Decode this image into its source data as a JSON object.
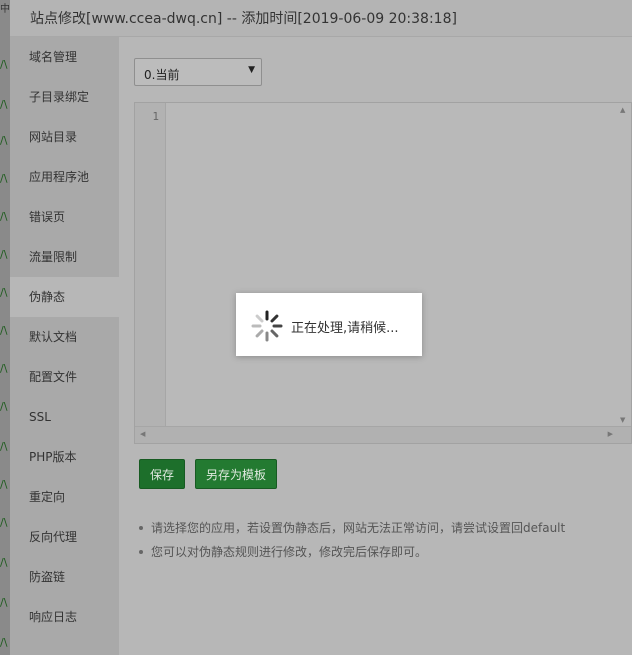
{
  "dialog": {
    "title": "站点修改[www.ccea-dwq.cn] -- 添加时间[2019-06-09 20:38:18]"
  },
  "background": {
    "top_char": "中",
    "glyph": "/\\"
  },
  "sidebar": {
    "active_index": 6,
    "items": [
      {
        "label": "域名管理"
      },
      {
        "label": "子目录绑定"
      },
      {
        "label": "网站目录"
      },
      {
        "label": "应用程序池"
      },
      {
        "label": "错误页"
      },
      {
        "label": "流量限制"
      },
      {
        "label": "伪静态"
      },
      {
        "label": "默认文档"
      },
      {
        "label": "配置文件"
      },
      {
        "label": "SSL"
      },
      {
        "label": "PHP版本"
      },
      {
        "label": "重定向"
      },
      {
        "label": "反向代理"
      },
      {
        "label": "防盗链"
      },
      {
        "label": "响应日志"
      }
    ]
  },
  "rewrite": {
    "select_value": "0.当前",
    "editor_line_number": "1",
    "editor_content": ""
  },
  "buttons": {
    "save_label": "保存",
    "save_as_template_label": "另存为模板"
  },
  "tips": [
    "请选择您的应用，若设置伪静态后，网站无法正常访问，请尝试设置回default",
    "您可以对伪静态规则进行修改，修改完后保存即可。"
  ],
  "loading": {
    "text": "正在处理,请稍候..."
  },
  "colors": {
    "accent_green": "#1d6f2b",
    "overlay_gray": "#b7b7b7"
  }
}
